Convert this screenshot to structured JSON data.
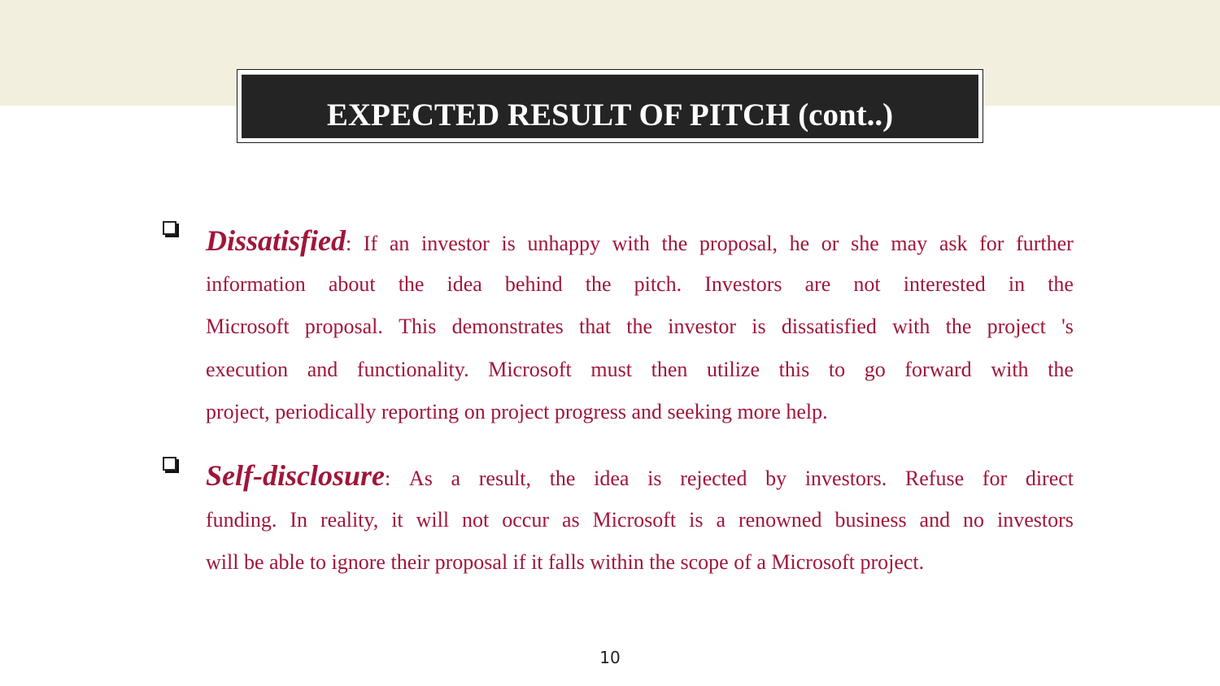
{
  "slide": {
    "title": "EXPECTED RESULT OF PITCH (cont..)",
    "page_number": "10",
    "text_color": "#a0163a",
    "band_color": "#f2efdf",
    "title_bg": "#242424"
  },
  "bullets": [
    {
      "icon": "checkbox-square-icon",
      "term": "Dissatisfied",
      "lines": [
        ": If an investor is unhappy with the proposal, he or she may ask for further",
        "information about the idea behind the pitch. Investors are not interested in the",
        "Microsoft proposal. This demonstrates that the investor is dissatisfied with the project 's",
        "execution and functionality. Microsoft must then utilize this to go forward with the",
        "project, periodically reporting on project progress and seeking more help."
      ]
    },
    {
      "icon": "checkbox-square-icon",
      "term": "Self-disclosure",
      "lines": [
        ": As a result, the idea is rejected by investors. Refuse for direct",
        "funding.    In reality, it will not occur as Microsoft is a renowned business and no investors",
        "will be able to ignore their proposal if it falls within the scope of a Microsoft project."
      ]
    }
  ]
}
